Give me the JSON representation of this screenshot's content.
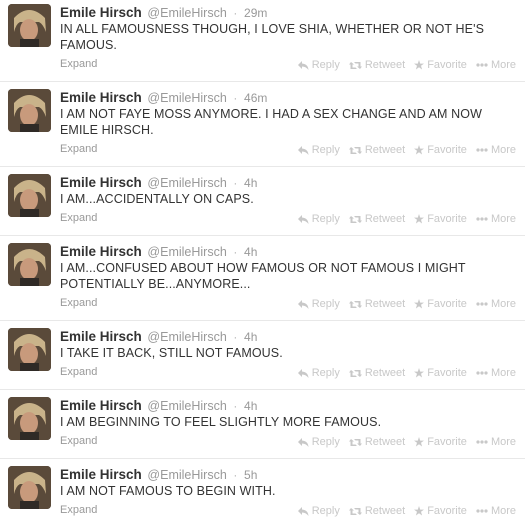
{
  "tweets": [
    {
      "name": "Emile Hirsch",
      "handle": "@EmileHirsch",
      "time": "29m",
      "text": "IN ALL FAMOUSNESS THOUGH,  I LOVE SHIA, WHETHER OR NOT HE'S FAMOUS.",
      "expand": "Expand"
    },
    {
      "name": "Emile Hirsch",
      "handle": "@EmileHirsch",
      "time": "46m",
      "text": "I AM NOT FAYE MOSS ANYMORE.   I HAD A SEX CHANGE AND AM NOW EMILE HIRSCH.",
      "expand": "Expand"
    },
    {
      "name": "Emile Hirsch",
      "handle": "@EmileHirsch",
      "time": "4h",
      "text": "I AM...ACCIDENTALLY ON CAPS.",
      "expand": "Expand"
    },
    {
      "name": "Emile Hirsch",
      "handle": "@EmileHirsch",
      "time": "4h",
      "text": "I AM...CONFUSED ABOUT HOW FAMOUS OR NOT FAMOUS I MIGHT POTENTIALLY BE...ANYMORE...",
      "expand": "Expand"
    },
    {
      "name": "Emile Hirsch",
      "handle": "@EmileHirsch",
      "time": "4h",
      "text": "I TAKE IT BACK, STILL NOT FAMOUS.",
      "expand": "Expand"
    },
    {
      "name": "Emile Hirsch",
      "handle": "@EmileHirsch",
      "time": "4h",
      "text": "I AM BEGINNING TO FEEL SLIGHTLY MORE FAMOUS.",
      "expand": "Expand"
    },
    {
      "name": "Emile Hirsch",
      "handle": "@EmileHirsch",
      "time": "5h",
      "text": "I AM NOT FAMOUS TO BEGIN WITH.",
      "expand": "Expand"
    }
  ],
  "actions": {
    "reply": "Reply",
    "retweet": "Retweet",
    "favorite": "Favorite",
    "more": "More"
  },
  "separator": "·",
  "icons": {
    "reply": "reply-icon",
    "retweet": "retweet-icon",
    "favorite": "star-icon",
    "more": "more-dots-icon"
  }
}
